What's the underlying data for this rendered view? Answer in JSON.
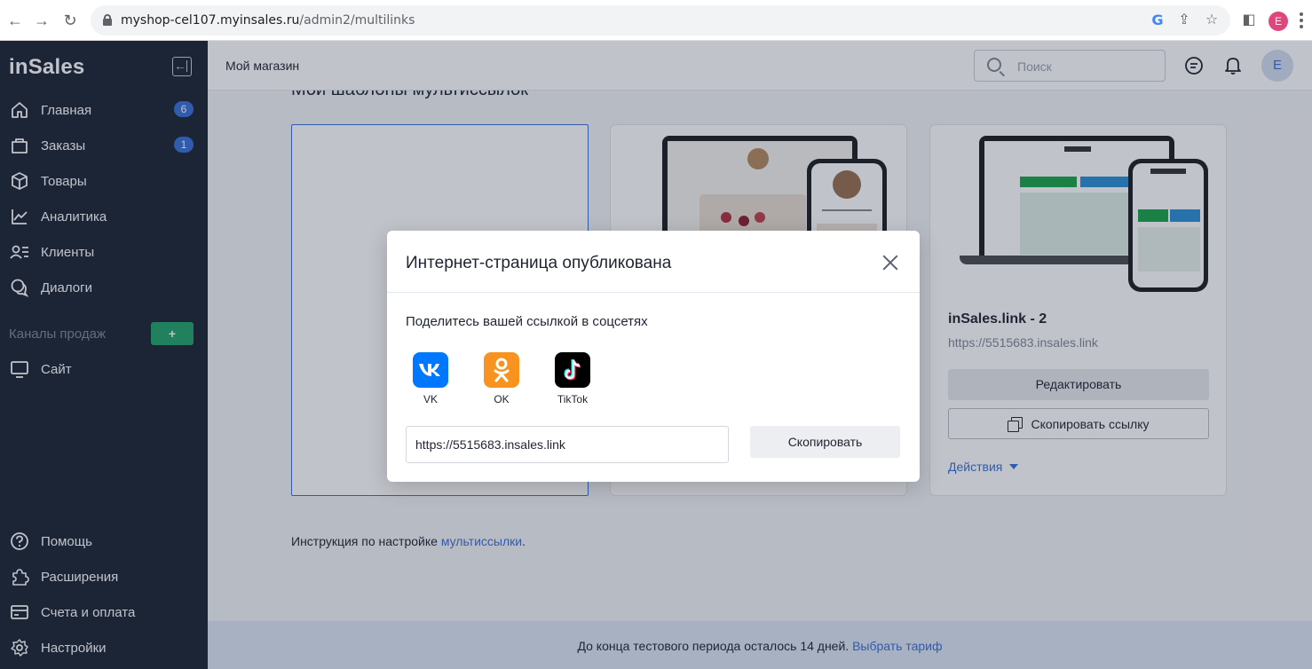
{
  "browser": {
    "url_host": "myshop-cel107.myinsales.ru",
    "url_path": "/admin2/multilinks",
    "profile_initial": "E"
  },
  "sidebar": {
    "logo": "inSales",
    "items": [
      {
        "label": "Главная",
        "icon": "home-icon",
        "badge": "6"
      },
      {
        "label": "Заказы",
        "icon": "cart-icon",
        "badge": "1"
      },
      {
        "label": "Товары",
        "icon": "box-icon"
      },
      {
        "label": "Аналитика",
        "icon": "analytics-icon"
      },
      {
        "label": "Клиенты",
        "icon": "clients-icon"
      },
      {
        "label": "Диалоги",
        "icon": "dialogs-icon"
      }
    ],
    "channels_title": "Каналы продаж",
    "add_channel_label": "+",
    "channel_items": [
      {
        "label": "Сайт",
        "icon": "monitor-icon"
      }
    ],
    "bottom_items": [
      {
        "label": "Помощь",
        "icon": "help-icon"
      },
      {
        "label": "Расширения",
        "icon": "puzzle-icon"
      },
      {
        "label": "Счета и оплата",
        "icon": "billing-icon"
      },
      {
        "label": "Настройки",
        "icon": "gear-icon"
      }
    ]
  },
  "header": {
    "shop_name": "Мой магазин",
    "search_placeholder": "Поиск",
    "avatar_initial": "E"
  },
  "main": {
    "title": "Мои шаблоны мультиссылок",
    "card": {
      "name": "inSales.link - 2",
      "url": "https://5515683.insales.link",
      "edit_label": "Редактировать",
      "copy_label": "Скопировать ссылку",
      "actions_label": "Действия"
    },
    "instructions_prefix": "Инструкция по настройке ",
    "instructions_link": "мультиссылки",
    "instructions_suffix": "."
  },
  "trial": {
    "text": "До конца тестового периода осталось 14 дней. ",
    "link": "Выбрать тариф"
  },
  "modal": {
    "title": "Интернет-страница опубликована",
    "subtitle": "Поделитесь вашей ссылкой в соцсетях",
    "share": [
      {
        "name": "VK",
        "icon": "vk-icon",
        "color": "#0077ff"
      },
      {
        "name": "OK",
        "icon": "ok-icon",
        "color": "#f7931e"
      },
      {
        "name": "TikTok",
        "icon": "tiktok-icon",
        "color": "#000000"
      }
    ],
    "link_value": "https://5515683.insales.link",
    "copy_label": "Скопировать"
  }
}
